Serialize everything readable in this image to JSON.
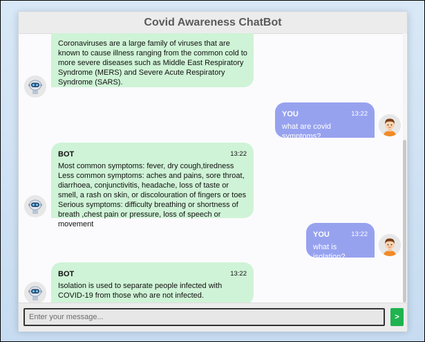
{
  "app": {
    "title": "Covid Awareness ChatBot"
  },
  "messages": [
    {
      "sender": "BOT",
      "time": "",
      "text": "Coronaviruses are a large family of viruses that are known to cause illness ranging from the common cold to more severe diseases such as Middle East Respiratory Syndrome (MERS) and Severe Acute Respiratory Syndrome (SARS)."
    },
    {
      "sender": "YOU",
      "time": "13:22",
      "text": "what are covid symptoms?"
    },
    {
      "sender": "BOT",
      "time": "13:22",
      "text": "Most common symptoms: fever, dry cough,tiredness Less common symptoms: aches and pains, sore throat, diarrhoea, conjunctivitis, headache, loss of taste or smell, a rash on skin, or discolouration of fingers or toes Serious symptoms: difficulty breathing or shortness of breath ,chest pain or pressure, loss of speech or movement"
    },
    {
      "sender": "YOU",
      "time": "13:22",
      "text": "what is isolation?"
    },
    {
      "sender": "BOT",
      "time": "13:22",
      "text": "Isolation is used to separate people infected with COVID-19 from those who are not infected."
    }
  ],
  "composer": {
    "placeholder": "Enter your message...",
    "send_label": ">"
  },
  "icons": {
    "bot_avatar": "robot-icon",
    "user_avatar": "boy-icon",
    "send": "send-icon"
  },
  "colors": {
    "bot_bubble": "#cff3d6",
    "user_bubble": "#97a2ef",
    "send_button": "#1fb34f"
  }
}
